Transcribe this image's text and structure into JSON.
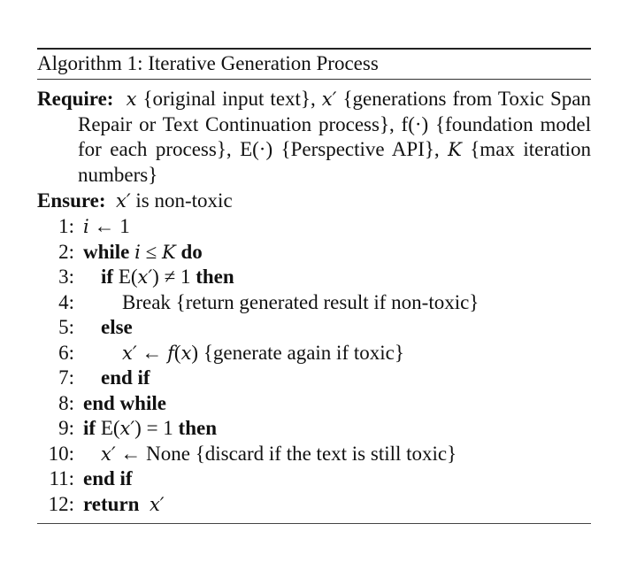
{
  "caption": "Algorithm 1: Iterative Generation Process",
  "require": {
    "label": "Require:",
    "text": "x {original input text}, x′ {generations from Toxic Span Repair or Text Continuation process}, f(·) {foundation model for each process}, E(·) {Perspective API}, K {max iteration numbers}"
  },
  "ensure": {
    "label": "Ensure:",
    "text": "x′ is non-toxic"
  },
  "lines": [
    {
      "num": "1:",
      "text": "i ← 1"
    },
    {
      "num": "2:",
      "text": "while i ≤ K do"
    },
    {
      "num": "3:",
      "text": "if E(x′) ≠ 1 then"
    },
    {
      "num": "4:",
      "text": "Break {return generated result if non-toxic}"
    },
    {
      "num": "5:",
      "text": "else"
    },
    {
      "num": "6:",
      "text": "x′ ← f(x) {generate again if toxic}"
    },
    {
      "num": "7:",
      "text": "end if"
    },
    {
      "num": "8:",
      "text": "end while"
    },
    {
      "num": "9:",
      "text": "if E(x′) = 1 then"
    },
    {
      "num": "10:",
      "text": "x′ ← None {discard if the text is still toxic}"
    },
    {
      "num": "11:",
      "text": "end if"
    },
    {
      "num": "12:",
      "text": "return x′"
    }
  ]
}
